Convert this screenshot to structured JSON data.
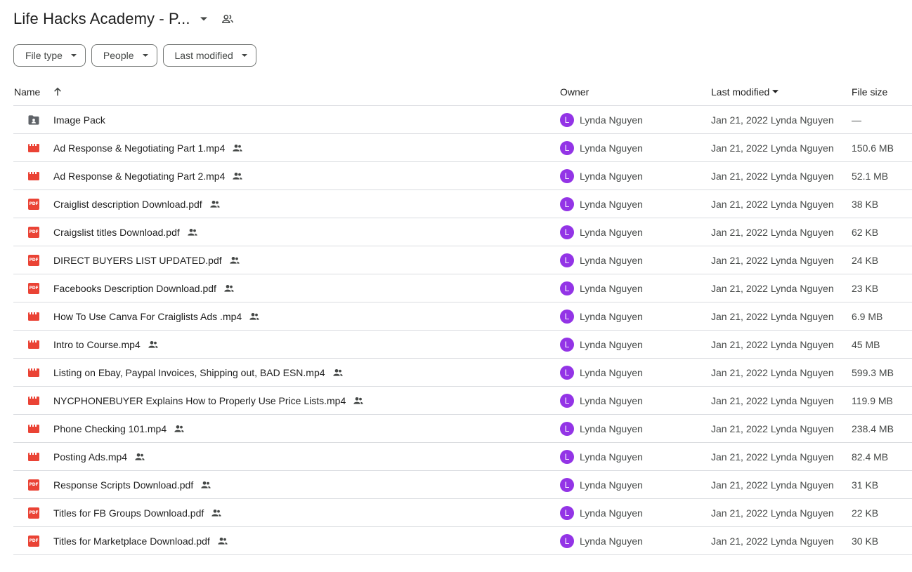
{
  "header": {
    "title": "Life Hacks Academy - P..."
  },
  "filters": [
    {
      "label": "File type"
    },
    {
      "label": "People"
    },
    {
      "label": "Last modified"
    }
  ],
  "columns": {
    "name": "Name",
    "owner": "Owner",
    "last_modified": "Last modified",
    "file_size": "File size"
  },
  "colors": {
    "video": "#ea4335",
    "pdf": "#ea4335",
    "folder": "#5f6368",
    "avatar": "#9334e6"
  },
  "rows": [
    {
      "type": "folder",
      "name": "Image Pack",
      "shared": false,
      "owner": "Lynda Nguyen",
      "avatar": "L",
      "modified": "Jan 21, 2022 Lynda Nguyen",
      "size": "—"
    },
    {
      "type": "video",
      "name": "Ad Response & Negotiating Part 1.mp4",
      "shared": true,
      "owner": "Lynda Nguyen",
      "avatar": "L",
      "modified": "Jan 21, 2022 Lynda Nguyen",
      "size": "150.6 MB"
    },
    {
      "type": "video",
      "name": "Ad Response & Negotiating Part 2.mp4",
      "shared": true,
      "owner": "Lynda Nguyen",
      "avatar": "L",
      "modified": "Jan 21, 2022 Lynda Nguyen",
      "size": "52.1 MB"
    },
    {
      "type": "pdf",
      "name": "Craiglist description Download.pdf",
      "shared": true,
      "owner": "Lynda Nguyen",
      "avatar": "L",
      "modified": "Jan 21, 2022 Lynda Nguyen",
      "size": "38 KB"
    },
    {
      "type": "pdf",
      "name": "Craigslist titles Download.pdf",
      "shared": true,
      "owner": "Lynda Nguyen",
      "avatar": "L",
      "modified": "Jan 21, 2022 Lynda Nguyen",
      "size": "62 KB"
    },
    {
      "type": "pdf",
      "name": "DIRECT BUYERS LIST UPDATED.pdf",
      "shared": true,
      "owner": "Lynda Nguyen",
      "avatar": "L",
      "modified": "Jan 21, 2022 Lynda Nguyen",
      "size": "24 KB"
    },
    {
      "type": "pdf",
      "name": "Facebooks Description Download.pdf",
      "shared": true,
      "owner": "Lynda Nguyen",
      "avatar": "L",
      "modified": "Jan 21, 2022 Lynda Nguyen",
      "size": "23 KB"
    },
    {
      "type": "video",
      "name": "How To Use Canva For Craiglists Ads  .mp4",
      "shared": true,
      "owner": "Lynda Nguyen",
      "avatar": "L",
      "modified": "Jan 21, 2022 Lynda Nguyen",
      "size": "6.9 MB"
    },
    {
      "type": "video",
      "name": "Intro to Course.mp4",
      "shared": true,
      "owner": "Lynda Nguyen",
      "avatar": "L",
      "modified": "Jan 21, 2022 Lynda Nguyen",
      "size": "45 MB"
    },
    {
      "type": "video",
      "name": "Listing on Ebay,  Paypal Invoices, Shipping out, BAD ESN.mp4",
      "shared": true,
      "owner": "Lynda Nguyen",
      "avatar": "L",
      "modified": "Jan 21, 2022 Lynda Nguyen",
      "size": "599.3 MB"
    },
    {
      "type": "video",
      "name": "NYCPHONEBUYER Explains How to Properly Use Price Lists.mp4",
      "shared": true,
      "owner": "Lynda Nguyen",
      "avatar": "L",
      "modified": "Jan 21, 2022 Lynda Nguyen",
      "size": "119.9 MB"
    },
    {
      "type": "video",
      "name": "Phone Checking 101.mp4",
      "shared": true,
      "owner": "Lynda Nguyen",
      "avatar": "L",
      "modified": "Jan 21, 2022 Lynda Nguyen",
      "size": "238.4 MB"
    },
    {
      "type": "video",
      "name": "Posting Ads.mp4",
      "shared": true,
      "owner": "Lynda Nguyen",
      "avatar": "L",
      "modified": "Jan 21, 2022 Lynda Nguyen",
      "size": "82.4 MB"
    },
    {
      "type": "pdf",
      "name": "Response Scripts Download.pdf",
      "shared": true,
      "owner": "Lynda Nguyen",
      "avatar": "L",
      "modified": "Jan 21, 2022 Lynda Nguyen",
      "size": "31 KB"
    },
    {
      "type": "pdf",
      "name": "Titles for FB Groups Download.pdf",
      "shared": true,
      "owner": "Lynda Nguyen",
      "avatar": "L",
      "modified": "Jan 21, 2022 Lynda Nguyen",
      "size": "22 KB"
    },
    {
      "type": "pdf",
      "name": "Titles for Marketplace Download.pdf",
      "shared": true,
      "owner": "Lynda Nguyen",
      "avatar": "L",
      "modified": "Jan 21, 2022 Lynda Nguyen",
      "size": "30 KB"
    }
  ],
  "pdf_badge": "PDF"
}
